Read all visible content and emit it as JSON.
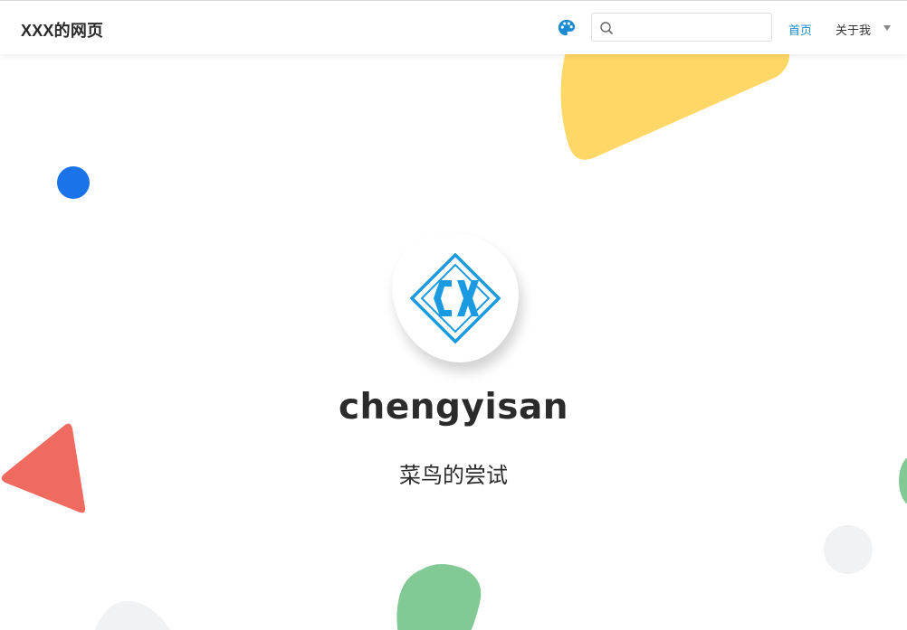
{
  "navbar": {
    "brand": "XXX的网页",
    "palette_icon": "palette-icon",
    "search": {
      "placeholder": "",
      "value": "",
      "icon": "search-icon"
    },
    "links": {
      "home": "首页",
      "about": "关于我"
    },
    "about_dropdown_icon": "caret-down-icon"
  },
  "hero": {
    "avatar_logo": "cx-diamond-logo",
    "title": "chengyisan",
    "subtitle": "菜鸟的尝试"
  },
  "colors": {
    "accent": "#1a8ccf",
    "logo_blue": "#1a9ae0",
    "deco_yellow": "#fed766",
    "deco_blue": "#1a73e8",
    "deco_red": "#ef6a5f",
    "deco_green": "#83c995",
    "deco_gray": "#f1f2f4"
  }
}
